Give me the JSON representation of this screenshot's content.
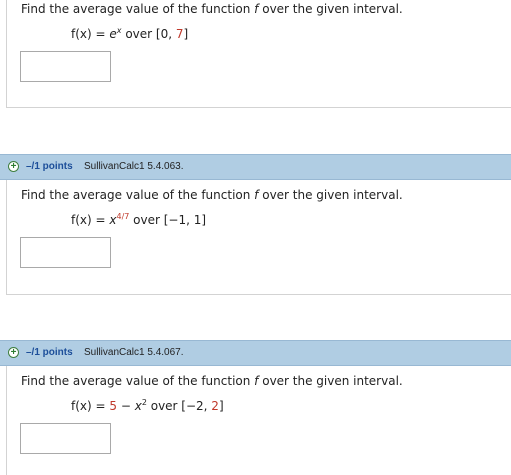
{
  "questions": [
    {
      "prompt_pre": "Find the average value of the function ",
      "prompt_f": "f",
      "prompt_post": " over the given interval.",
      "lhs": "f(x) = ",
      "body": "e",
      "exp": "x",
      "over": " over [0, ",
      "interval_end": "7",
      "close": "]",
      "answer_value": ""
    },
    {
      "header": {
        "points": "–/1 points",
        "ref": "SullivanCalc1 5.4.063."
      },
      "prompt_pre": "Find the average value of the function ",
      "prompt_f": "f",
      "prompt_post": " over the given interval.",
      "lhs": "f(x) = ",
      "body": "x",
      "exp": "4/7",
      "interval": " over [−1, 1]",
      "answer_value": ""
    },
    {
      "header": {
        "points": "–/1 points",
        "ref": "SullivanCalc1 5.4.067."
      },
      "prompt_pre": "Find the average value of the function ",
      "prompt_f": "f",
      "prompt_post": " over the given interval.",
      "lhs": "f(x) = ",
      "const": "5",
      "minus": " − ",
      "body": "x",
      "exp": "2",
      "over": " over [−2, ",
      "interval_end": "2",
      "close": "]",
      "answer_value": ""
    }
  ],
  "colors": {
    "header_bg": "#b0cde3",
    "points_text": "#1d4f9a",
    "highlight_number": "#c0392b",
    "expand_icon": "#2e7d32"
  },
  "icons": {
    "expand": "plus-circle-icon"
  }
}
